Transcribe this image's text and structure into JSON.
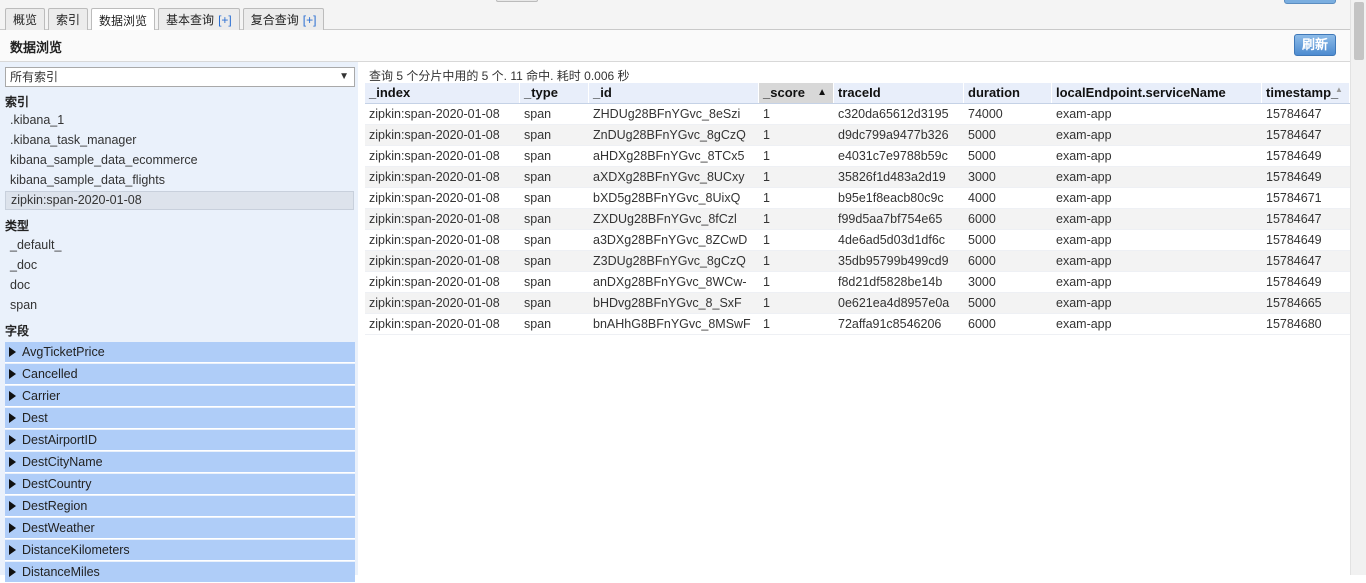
{
  "tabs": [
    {
      "label": "概览",
      "plus": ""
    },
    {
      "label": "索引",
      "plus": ""
    },
    {
      "label": "数据浏览",
      "plus": ""
    },
    {
      "label": "基本查询",
      "plus": "[+]"
    },
    {
      "label": "复合查询",
      "plus": "[+]"
    }
  ],
  "section": {
    "title": "数据浏览",
    "refresh_label": "刷新"
  },
  "sidebar": {
    "index_select": "所有索引",
    "indices_heading": "索引",
    "indices": [
      ".kibana_1",
      ".kibana_task_manager",
      "kibana_sample_data_ecommerce",
      "kibana_sample_data_flights",
      "zipkin:span-2020-01-08"
    ],
    "types_heading": "类型",
    "types": [
      "_default_",
      "_doc",
      "doc",
      "span"
    ],
    "fields_heading": "字段",
    "fields": [
      "AvgTicketPrice",
      "Cancelled",
      "Carrier",
      "Dest",
      "DestAirportID",
      "DestCityName",
      "DestCountry",
      "DestRegion",
      "DestWeather",
      "DistanceKilometers",
      "DistanceMiles"
    ]
  },
  "results": {
    "summary": "查询 5 个分片中用的 5 个. 11 命中. 耗时 0.006 秒",
    "columns": [
      "_index",
      "_type",
      "_id",
      "_score",
      "traceId",
      "duration",
      "localEndpoint.serviceName",
      "timestamp_"
    ],
    "sort_indicator": "▲",
    "rows": [
      [
        "zipkin:span-2020-01-08",
        "span",
        "ZHDUg28BFnYGvc_8eSzi",
        "1",
        "c320da65612d3195",
        "74000",
        "exam-app",
        "15784647"
      ],
      [
        "zipkin:span-2020-01-08",
        "span",
        "ZnDUg28BFnYGvc_8gCzQ",
        "1",
        "d9dc799a9477b326",
        "5000",
        "exam-app",
        "15784647"
      ],
      [
        "zipkin:span-2020-01-08",
        "span",
        "aHDXg28BFnYGvc_8TCx5",
        "1",
        "e4031c7e9788b59c",
        "5000",
        "exam-app",
        "15784649"
      ],
      [
        "zipkin:span-2020-01-08",
        "span",
        "aXDXg28BFnYGvc_8UCxy",
        "1",
        "35826f1d483a2d19",
        "3000",
        "exam-app",
        "15784649"
      ],
      [
        "zipkin:span-2020-01-08",
        "span",
        "bXD5g28BFnYGvc_8UixQ",
        "1",
        "b95e1f8eacb80c9c",
        "4000",
        "exam-app",
        "15784671"
      ],
      [
        "zipkin:span-2020-01-08",
        "span",
        "ZXDUg28BFnYGvc_8fCzl",
        "1",
        "f99d5aa7bf754e65",
        "6000",
        "exam-app",
        "15784647"
      ],
      [
        "zipkin:span-2020-01-08",
        "span",
        "a3DXg28BFnYGvc_8ZCwD",
        "1",
        "4de6ad5d03d1df6c",
        "5000",
        "exam-app",
        "15784649"
      ],
      [
        "zipkin:span-2020-01-08",
        "span",
        "Z3DUg28BFnYGvc_8gCzQ",
        "1",
        "35db95799b499cd9",
        "6000",
        "exam-app",
        "15784647"
      ],
      [
        "zipkin:span-2020-01-08",
        "span",
        "anDXg28BFnYGvc_8WCw-",
        "1",
        "f8d21df5828be14b",
        "3000",
        "exam-app",
        "15784649"
      ],
      [
        "zipkin:span-2020-01-08",
        "span",
        "bHDvg28BFnYGvc_8_SxF",
        "1",
        "0e621ea4d8957e0a",
        "5000",
        "exam-app",
        "15784665"
      ],
      [
        "zipkin:span-2020-01-08",
        "span",
        "bnAHhG8BFnYGvc_8MSwF",
        "1",
        "72affa91c8546206",
        "6000",
        "exam-app",
        "15784680"
      ]
    ]
  }
}
